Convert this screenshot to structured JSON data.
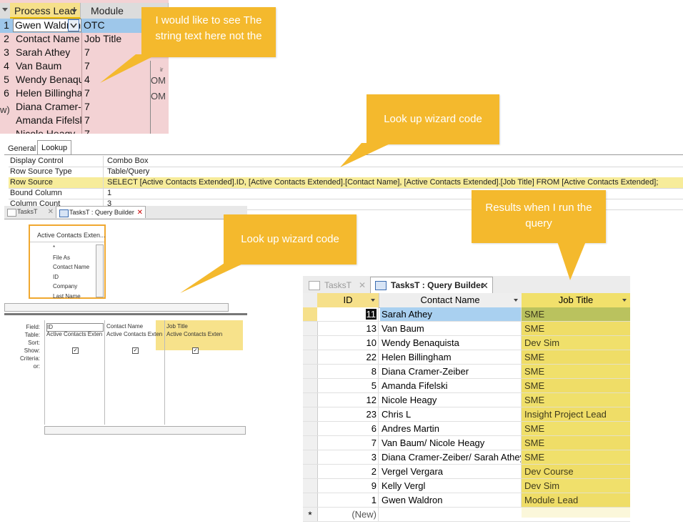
{
  "datasheet": {
    "columns": [
      "Process Lead",
      "Module"
    ],
    "selected_row": {
      "num": "1",
      "name": "Gwen Waldron",
      "module": "OTC"
    },
    "dropdown_header": [
      "Contact Name",
      "Job Title"
    ],
    "rows": [
      {
        "num": "3",
        "name": "Sarah Athey",
        "val": "7"
      },
      {
        "num": "4",
        "name": "Van Baum",
        "val": "7"
      },
      {
        "num": "5",
        "name": "Wendy Benaquista",
        "val": "4"
      },
      {
        "num": "6",
        "name": "Helen Billingham",
        "val": "7"
      },
      {
        "num": "",
        "name": "Diana Cramer-Zeiber",
        "val": "7"
      },
      {
        "num": "",
        "name": "Amanda Fifelski",
        "val": "7"
      },
      {
        "num": "",
        "name": "Nicole Heagy",
        "val": "7"
      }
    ],
    "row_2_num": "2",
    "new_row_label": "w)",
    "side_values": [
      "OM",
      "OM"
    ],
    "side_fragment": "ir"
  },
  "callouts": {
    "top": "I would like to see The string text here not the",
    "lookup1": "Look up wizard code",
    "lookup2": "Look up wizard code",
    "results": "Results when I run the query"
  },
  "property_sheet": {
    "tabs": [
      "General",
      "Lookup"
    ],
    "rows": [
      {
        "key": "Display Control",
        "value": "Combo Box"
      },
      {
        "key": "Row Source Type",
        "value": "Table/Query"
      },
      {
        "key": "Row Source",
        "value": "SELECT [Active Contacts Extended].ID, [Active Contacts Extended].[Contact Name], [Active Contacts Extended].[Job Title] FROM [Active Contacts Extended];"
      },
      {
        "key": "Bound Column",
        "value": "1"
      },
      {
        "key": "Column Count",
        "value": "3"
      }
    ]
  },
  "small_query": {
    "tabs": [
      "TasksT",
      "TasksT : Query Builder"
    ],
    "table_title": "Active Contacts Exten...",
    "fields": [
      "*",
      "File As",
      "Contact Name",
      "ID",
      "Company",
      "Last Name"
    ],
    "grid_labels": [
      "Field:",
      "Table:",
      "Sort:",
      "Show:",
      "Criteria:",
      "or:"
    ],
    "columns": [
      {
        "field": "ID",
        "table": "Active Contacts Exten"
      },
      {
        "field": "Contact Name",
        "table": "Active Contacts Exten"
      },
      {
        "field": "Job Title",
        "table": "Active Contacts Exten"
      }
    ]
  },
  "results": {
    "tabs": [
      "TasksT",
      "TasksT : Query Builder"
    ],
    "headers": [
      "ID",
      "Contact Name",
      "Job Title"
    ],
    "rows": [
      {
        "id": "11",
        "name": "Sarah Athey",
        "job": "SME"
      },
      {
        "id": "13",
        "name": "Van Baum",
        "job": "SME"
      },
      {
        "id": "10",
        "name": "Wendy Benaquista",
        "job": "Dev Sim"
      },
      {
        "id": "22",
        "name": "Helen Billingham",
        "job": "SME"
      },
      {
        "id": "8",
        "name": "Diana Cramer-Zeiber",
        "job": "SME"
      },
      {
        "id": "5",
        "name": "Amanda Fifelski",
        "job": "SME"
      },
      {
        "id": "12",
        "name": "Nicole Heagy",
        "job": "SME"
      },
      {
        "id": "23",
        "name": "Chris L",
        "job": "Insight Project Lead"
      },
      {
        "id": "6",
        "name": "Andres Martin",
        "job": "SME"
      },
      {
        "id": "7",
        "name": "Van Baum/ Nicole Heagy",
        "job": "SME"
      },
      {
        "id": "3",
        "name": "Diana Cramer-Zeiber/ Sarah Athey",
        "job": "SME"
      },
      {
        "id": "2",
        "name": "Vergel Vergara",
        "job": "Dev Course"
      },
      {
        "id": "9",
        "name": "Kelly Vergl",
        "job": "Dev Sim"
      },
      {
        "id": "1",
        "name": "Gwen Waldron",
        "job": "Module Lead"
      }
    ],
    "new_row": {
      "marker": "*",
      "id": "(New)"
    }
  },
  "colors": {
    "callout": "#f4b92d",
    "highlight": "#f1e06b",
    "selected": "#9ec7ea",
    "datasheet": "#f3d2d4"
  }
}
